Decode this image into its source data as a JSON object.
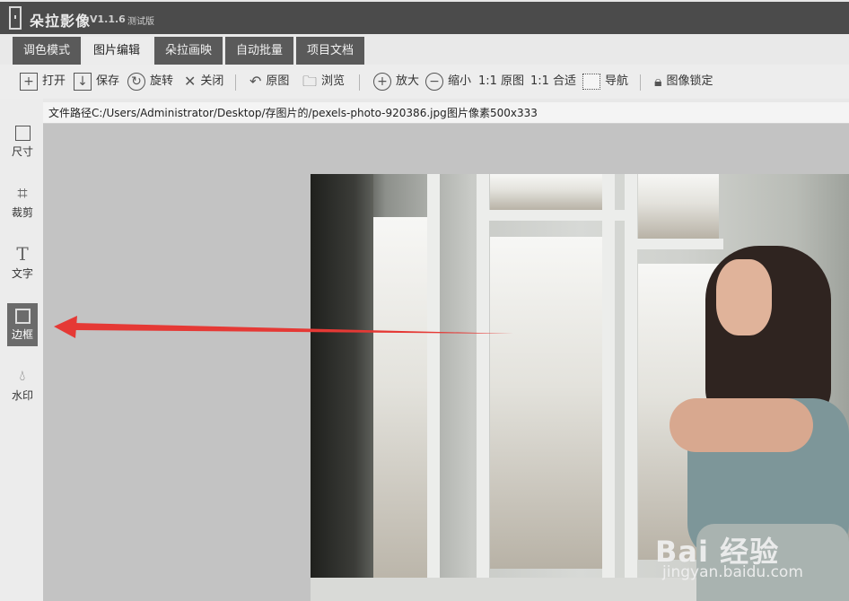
{
  "app": {
    "name": "朵拉影像",
    "version": "V1.1.6",
    "edition": "测试版"
  },
  "tabs": [
    {
      "label": "调色模式"
    },
    {
      "label": "图片编辑"
    },
    {
      "label": "朵拉画映"
    },
    {
      "label": "自动批量"
    },
    {
      "label": "项目文档"
    }
  ],
  "active_tab": "图片编辑",
  "toolbar": {
    "open": "打开",
    "save": "保存",
    "rotate": "旋转",
    "close": "关闭",
    "original": "原图",
    "browse": "浏览",
    "zoom_in": "放大",
    "zoom_out": "缩小",
    "actual_size": "1:1 原图",
    "fit": "1:1 合适",
    "navigate": "导航",
    "lock": "图像锁定"
  },
  "sidebar": {
    "items": [
      {
        "label": "尺寸",
        "icon": "resize-icon"
      },
      {
        "label": "裁剪",
        "icon": "crop-icon"
      },
      {
        "label": "文字",
        "icon": "text-icon"
      },
      {
        "label": "边框",
        "icon": "border-icon"
      },
      {
        "label": "水印",
        "icon": "watermark-icon"
      }
    ],
    "active": "边框"
  },
  "file_info": {
    "path": "文件路径C:/Users/Administrator/Desktop/存图片的/pexels-photo-920386.jpg",
    "size": "图片像素500x333"
  },
  "watermark": {
    "brand": "Bai 经验",
    "url": "jingyan.baidu.com"
  },
  "colors": {
    "titlebar": "#4b4b4b",
    "tab": "#5a5a5a",
    "arrow": "#e53935",
    "canvas": "#c3c3c3"
  }
}
